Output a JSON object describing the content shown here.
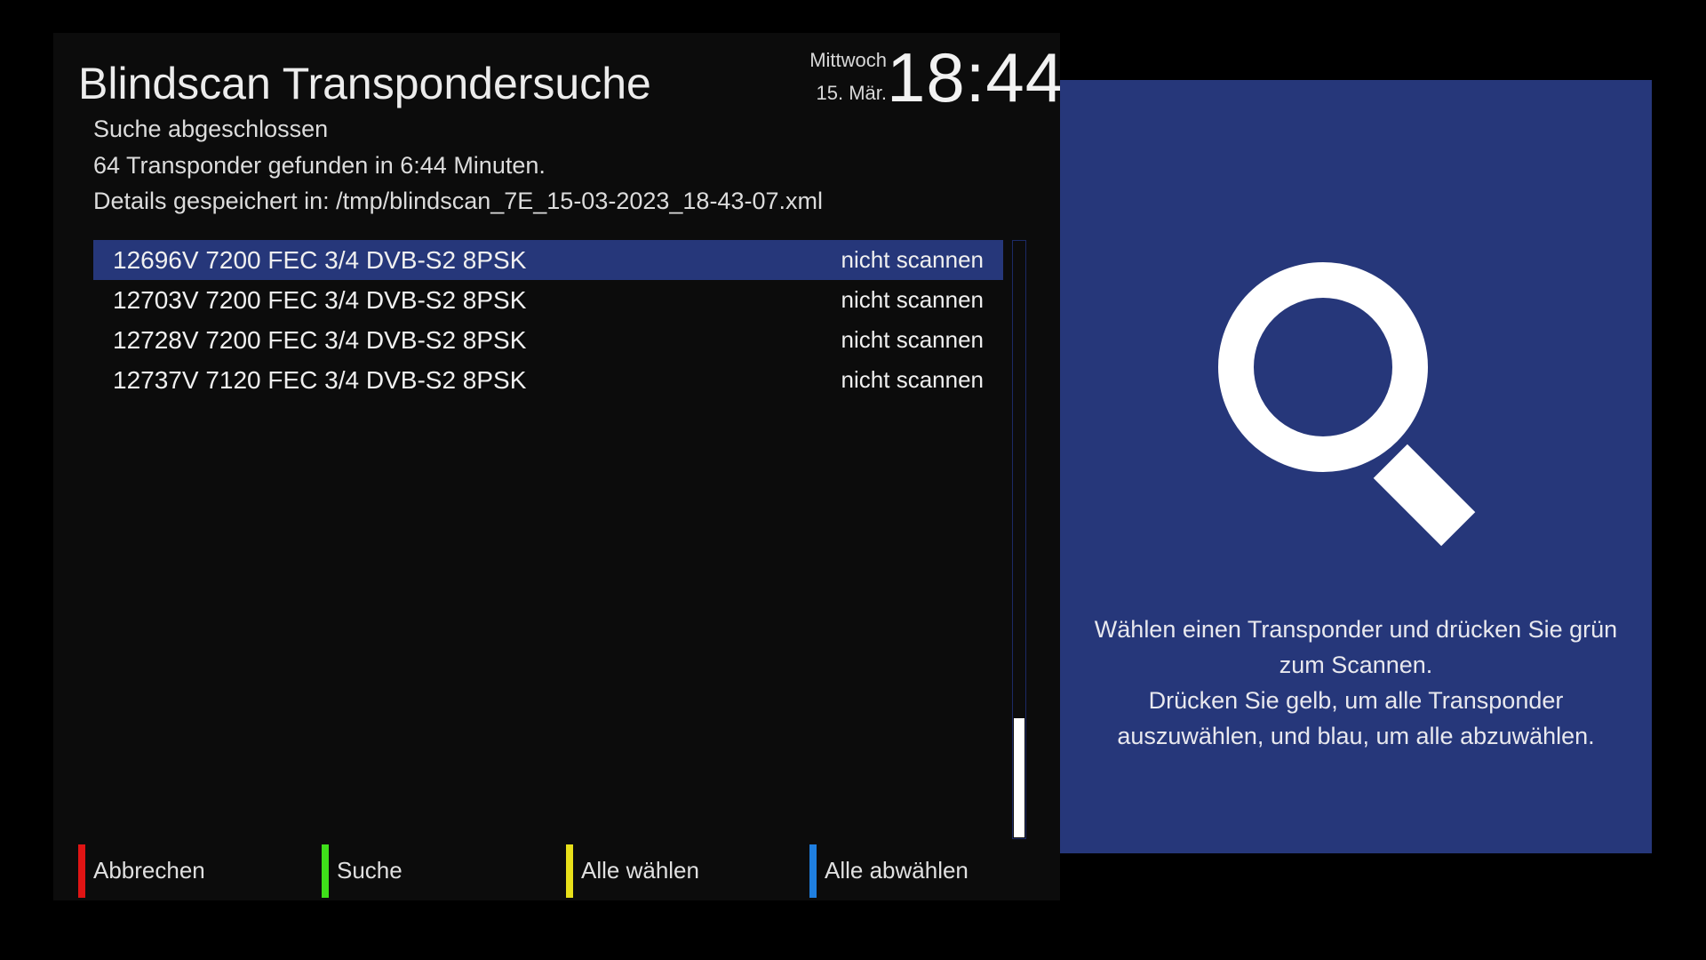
{
  "screen": {
    "title": "Blindscan Transpondersuche",
    "clock": {
      "weekday": "Mittwoch",
      "date": "15. Mär.",
      "time": "18:44"
    },
    "status": [
      "Suche abgeschlossen",
      "64 Transponder gefunden in 6:44 Minuten.",
      "Details gespeichert in: /tmp/blindscan_7E_15-03-2023_18-43-07.xml"
    ]
  },
  "transponders": [
    {
      "label": "12696V 7200 FEC 3/4 DVB-S2 8PSK",
      "state": "nicht scannen",
      "selected": true
    },
    {
      "label": "12703V 7200 FEC 3/4 DVB-S2 8PSK",
      "state": "nicht scannen",
      "selected": false
    },
    {
      "label": "12728V 7200 FEC 3/4 DVB-S2 8PSK",
      "state": "nicht scannen",
      "selected": false
    },
    {
      "label": "12737V 7120 FEC 3/4 DVB-S2 8PSK",
      "state": "nicht scannen",
      "selected": false
    }
  ],
  "scroll": {
    "position_fraction": 0.8
  },
  "color_keys": {
    "red": {
      "label": "Abbrechen",
      "color": "#e01414"
    },
    "green": {
      "label": "Suche",
      "color": "#3fe01a"
    },
    "yellow": {
      "label": "Alle wählen",
      "color": "#e8e01a"
    },
    "blue": {
      "label": "Alle abwählen",
      "color": "#1f7fe0"
    }
  },
  "info": {
    "icon": "magnifier-icon",
    "help_lines": [
      "Wählen einen Transponder und drücken Sie grün",
      "zum Scannen.",
      "Drücken Sie gelb, um alle Transponder",
      "auszuwählen, und blau, um alle abzuwählen."
    ]
  },
  "colors": {
    "accent": "#26377a",
    "panel_background": "#0c0c0c"
  }
}
